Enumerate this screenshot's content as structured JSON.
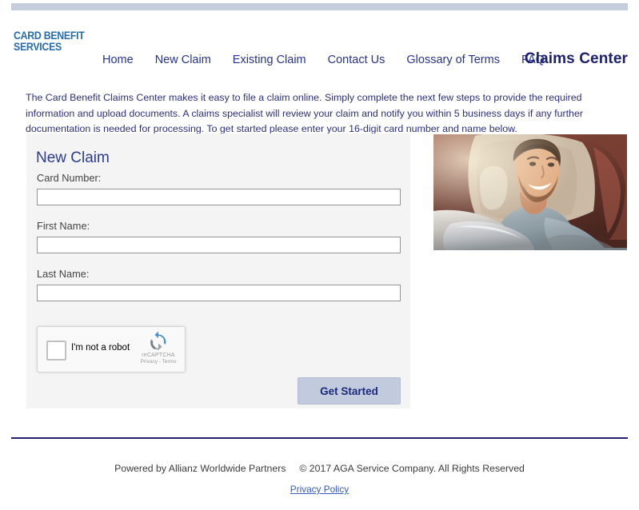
{
  "header": {
    "logo_line1": "CARD BENEFIT",
    "logo_line2": "SERVICES",
    "site_title": "Claims Center",
    "nav": [
      {
        "label": "Home"
      },
      {
        "label": "New Claim"
      },
      {
        "label": "Existing Claim"
      },
      {
        "label": "Contact Us"
      },
      {
        "label": "Glossary of Terms"
      },
      {
        "label": "FAQ"
      }
    ]
  },
  "intro": {
    "text": "The Card Benefit Claims Center makes it easy to file a claim online. Simply complete the next few steps to provide the required information and upload documents. A claims specialist will review your claim and notify you within 5 business days if any further documentation is needed for processing. To get started please enter your 16-digit card number and name below."
  },
  "form": {
    "title": "New Claim",
    "fields": [
      {
        "label": "Card Number:",
        "value": "",
        "placeholder": ""
      },
      {
        "label": "First Name:",
        "value": "",
        "placeholder": ""
      },
      {
        "label": "Last Name:",
        "value": "",
        "placeholder": ""
      }
    ],
    "recaptcha": {
      "label": "I'm not a robot",
      "brand": "reCAPTCHA",
      "terms": "Privacy - Terms",
      "checked": false
    },
    "submit_label": "Get Started"
  },
  "hero": {
    "alt": "Smiling man leaning out of a car window"
  },
  "footer": {
    "powered_by": "Powered by Allianz Worldwide Partners",
    "copyright": "© 2017 AGA Service Company. All Rights Reserved",
    "privacy_label": "Privacy Policy"
  },
  "colors": {
    "accent_bar": "#c5cddd",
    "nav_text": "#27348b",
    "logo_blue": "#2a6ca8",
    "title_navy": "#1c1f6b",
    "panel_bg": "#f4f4f4",
    "button_bg": "#c2cade",
    "divider": "#23216b",
    "link": "#3a5bb5"
  }
}
